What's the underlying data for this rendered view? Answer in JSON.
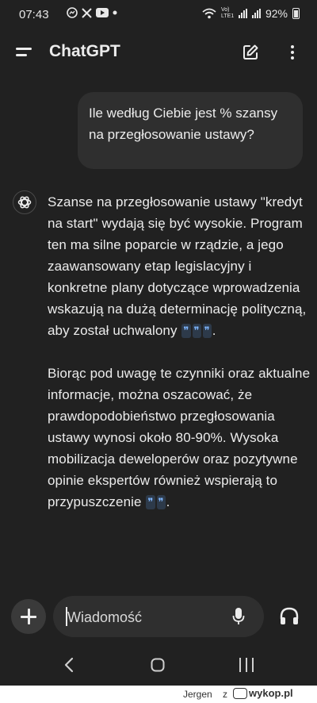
{
  "status_bar": {
    "time": "07:43",
    "notification_icons": [
      "messenger-icon",
      "x-icon",
      "youtube-icon",
      "dot-icon"
    ],
    "battery": "92%",
    "network_label": "Vo) LTE1"
  },
  "header": {
    "title": "ChatGPT"
  },
  "conversation": {
    "user_message": "Ile według Ciebie jest % szansy na przegłosowanie ustawy?",
    "assistant_paragraph_1": "Szanse na przegłosowanie ustawy \"kredyt na start\" wydają się być wysokie. Program ten ma silne poparcie w rządzie, a jego zaawansowany etap legislacyjny i konkretne plany dotyczące wprowadzenia wskazują na dużą determinację polityczną, aby został uchwalony",
    "assistant_paragraph_2": "Biorąc pod uwagę te czynniki oraz aktualne informacje, można oszacować, że prawdopodobieństwo przegłosowania ustawy wynosi około 80-90%. Wysoka mobilizacja deweloperów oraz pozytywne opinie ekspertów również wspierają to przypuszczenie",
    "citation_glyph": "❞",
    "punctuation_end": "."
  },
  "composer": {
    "placeholder": "Wiadomość"
  },
  "watermark": {
    "user": "Jergen",
    "z": "z",
    "site": "wykop.pl"
  },
  "colors": {
    "background": "#212121",
    "bubble": "#2f2f2f",
    "text": "#ececec",
    "citation": "#7fb6ff"
  }
}
